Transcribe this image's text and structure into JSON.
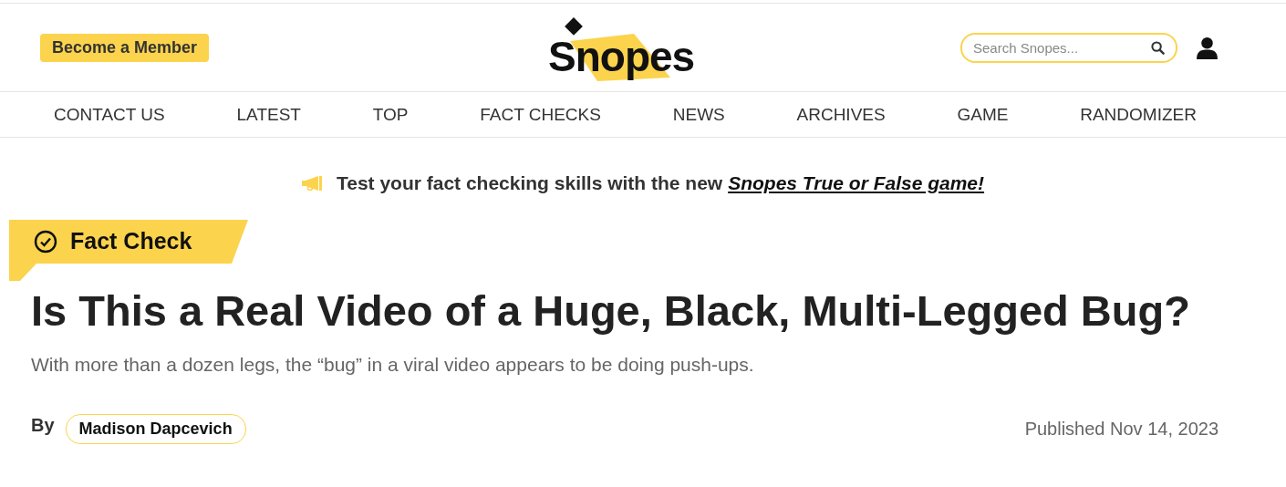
{
  "header": {
    "member_button": "Become a Member",
    "logo": "Snopes",
    "search": {
      "placeholder": "Search Snopes..."
    }
  },
  "nav": {
    "items": [
      {
        "label": "CONTACT US"
      },
      {
        "label": "LATEST"
      },
      {
        "label": "TOP"
      },
      {
        "label": "FACT CHECKS"
      },
      {
        "label": "NEWS"
      },
      {
        "label": "ARCHIVES"
      },
      {
        "label": "GAME"
      },
      {
        "label": "RANDOMIZER"
      }
    ]
  },
  "promo": {
    "text": "Test your fact checking skills with the new",
    "link": "Snopes True or False game!"
  },
  "article": {
    "badge": "Fact Check",
    "title": "Is This a Real Video of a Huge, Black, Multi-Legged Bug?",
    "subtitle": "With more than a dozen legs, the “bug” in a viral video appears to be doing push-ups.",
    "by": "By",
    "author": "Madison Dapcevich",
    "published": "Published Nov 14, 2023"
  }
}
